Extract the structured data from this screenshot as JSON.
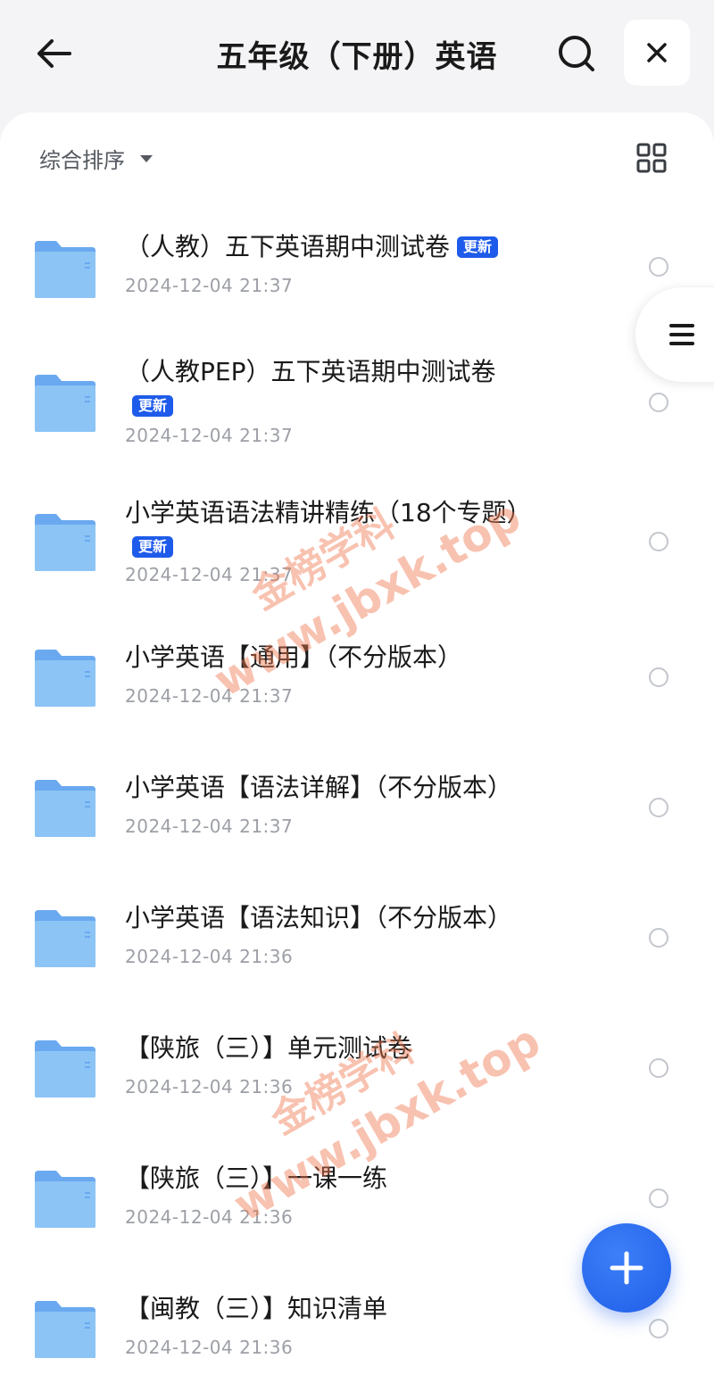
{
  "header": {
    "title": "五年级（下册）英语"
  },
  "toolbar": {
    "sort_label": "综合排序"
  },
  "items": [
    {
      "title": "（人教）五下英语期中测试卷",
      "badge": "更新",
      "date": "2024-12-04 21:37"
    },
    {
      "title": "（人教PEP）五下英语期中测试卷",
      "badge": "更新",
      "date": "2024-12-04 21:37"
    },
    {
      "title": "小学英语语法精讲精练（18个专题）",
      "badge": "更新",
      "date": "2024-12-04 21:37"
    },
    {
      "title": "小学英语【通用】（不分版本）",
      "badge": "",
      "date": "2024-12-04 21:37"
    },
    {
      "title": "小学英语【语法详解】（不分版本）",
      "badge": "",
      "date": "2024-12-04 21:37"
    },
    {
      "title": "小学英语【语法知识】（不分版本）",
      "badge": "",
      "date": "2024-12-04 21:36"
    },
    {
      "title": "【陕旅（三）】单元测试卷",
      "badge": "",
      "date": "2024-12-04 21:36"
    },
    {
      "title": "【陕旅（三）】一课一练",
      "badge": "",
      "date": "2024-12-04 21:36"
    },
    {
      "title": "【闽教（三）】知识清单",
      "badge": "",
      "date": "2024-12-04 21:36"
    }
  ],
  "watermark": {
    "brand": "金榜学科",
    "url": "www.jbxk.top"
  },
  "colors": {
    "accent": "#1e5bea",
    "folder": "#7fbaf3",
    "watermark": "#f07850"
  },
  "icons": {
    "back": "arrow-left-icon",
    "search": "search-icon",
    "close": "close-icon",
    "sort_caret": "caret-down-icon",
    "view_toggle": "grid-view-icon",
    "folder": "folder-icon",
    "side_menu": "menu-icon",
    "add": "plus-icon"
  }
}
